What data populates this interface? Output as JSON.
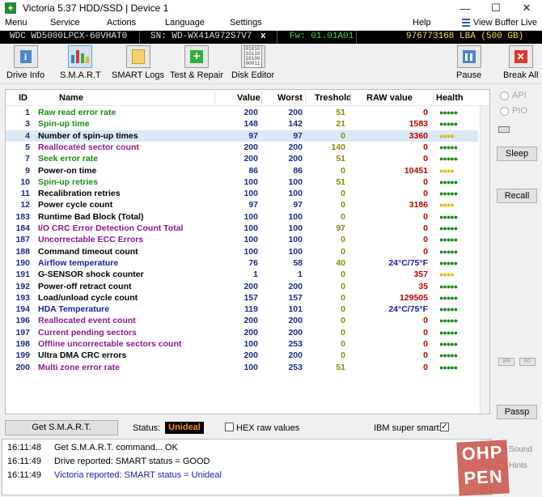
{
  "window": {
    "title": "Victoria 5.37 HDD/SSD | Device 1"
  },
  "menu": {
    "items": [
      "Menu",
      "Service",
      "Actions",
      "Language",
      "Settings",
      "Help"
    ],
    "buffer_live": "View Buffer Live"
  },
  "device": {
    "model": "WDC WD5000LPCX-60VHAT0",
    "serial": "SN: WD-WX41A972S7V7",
    "close": "x",
    "firmware": "Fw: 01.01A01",
    "lba": "976773168 LBA (500 GB)"
  },
  "toolbar": {
    "drive_info": "Drive Info",
    "smart": "S.M.A.R.T",
    "smart_logs": "SMART Logs",
    "test_repair": "Test & Repair",
    "disk_editor": "Disk Editor",
    "pause": "Pause",
    "break_all": "Break All",
    "disk_editor_glyph": "01010\n10110\n10100\n00011"
  },
  "table": {
    "headers": {
      "id": "ID",
      "name": "Name",
      "value": "Value",
      "worst": "Worst",
      "threshold": "Treshold",
      "raw": "RAW value",
      "health": "Health"
    },
    "rows": [
      {
        "id": "1",
        "name": "Raw read error rate",
        "value": "200",
        "worst": "200",
        "threshold": "51",
        "raw": "0",
        "health": "●●●●●",
        "name_color": "#1a8a1a",
        "health_color": "#1a8a1a"
      },
      {
        "id": "3",
        "name": "Spin-up time",
        "value": "148",
        "worst": "142",
        "threshold": "21",
        "raw": "1583",
        "health": "●●●●●",
        "name_color": "#1a8a1a",
        "health_color": "#1a8a1a"
      },
      {
        "id": "4",
        "name": "Number of spin-up times",
        "value": "97",
        "worst": "97",
        "threshold": "0",
        "raw": "3360",
        "health": "●●●●",
        "name_color": "#000000",
        "health_color": "#e8b800"
      },
      {
        "id": "5",
        "name": "Reallocated sector count",
        "value": "200",
        "worst": "200",
        "threshold": "140",
        "raw": "0",
        "health": "●●●●●",
        "name_color": "#8a1a8a",
        "health_color": "#1a8a1a"
      },
      {
        "id": "7",
        "name": "Seek error rate",
        "value": "200",
        "worst": "200",
        "threshold": "51",
        "raw": "0",
        "health": "●●●●●",
        "name_color": "#1a8a1a",
        "health_color": "#1a8a1a"
      },
      {
        "id": "9",
        "name": "Power-on time",
        "value": "86",
        "worst": "86",
        "threshold": "0",
        "raw": "10451",
        "health": "●●●●",
        "name_color": "#000000",
        "health_color": "#e8b800"
      },
      {
        "id": "10",
        "name": "Spin-up retries",
        "value": "100",
        "worst": "100",
        "threshold": "51",
        "raw": "0",
        "health": "●●●●●",
        "name_color": "#1a8a1a",
        "health_color": "#1a8a1a"
      },
      {
        "id": "11",
        "name": "Recalibration retries",
        "value": "100",
        "worst": "100",
        "threshold": "0",
        "raw": "0",
        "health": "●●●●●",
        "name_color": "#000000",
        "health_color": "#1a8a1a"
      },
      {
        "id": "12",
        "name": "Power cycle count",
        "value": "97",
        "worst": "97",
        "threshold": "0",
        "raw": "3186",
        "health": "●●●●",
        "name_color": "#000000",
        "health_color": "#e8b800"
      },
      {
        "id": "183",
        "name": "Runtime Bad Block (Total)",
        "value": "100",
        "worst": "100",
        "threshold": "0",
        "raw": "0",
        "health": "●●●●●",
        "name_color": "#000000",
        "health_color": "#1a8a1a"
      },
      {
        "id": "184",
        "name": "I/O CRC Error Detection Count Total",
        "value": "100",
        "worst": "100",
        "threshold": "97",
        "raw": "0",
        "health": "●●●●●",
        "name_color": "#8a1a8a",
        "health_color": "#1a8a1a"
      },
      {
        "id": "187",
        "name": "Uncorrectable ECC Errors",
        "value": "100",
        "worst": "100",
        "threshold": "0",
        "raw": "0",
        "health": "●●●●●",
        "name_color": "#8a1a8a",
        "health_color": "#1a8a1a"
      },
      {
        "id": "188",
        "name": "Command timeout count",
        "value": "100",
        "worst": "100",
        "threshold": "0",
        "raw": "0",
        "health": "●●●●●",
        "name_color": "#000000",
        "health_color": "#1a8a1a"
      },
      {
        "id": "190",
        "name": "Airflow temperature",
        "value": "76",
        "worst": "58",
        "threshold": "40",
        "raw": "24°C/75°F",
        "health": "●●●●●",
        "name_color": "#1a1aa8",
        "health_color": "#1a8a1a"
      },
      {
        "id": "191",
        "name": "G-SENSOR shock counter",
        "value": "1",
        "worst": "1",
        "threshold": "0",
        "raw": "357",
        "health": "●●●●",
        "name_color": "#000000",
        "health_color": "#e8b800"
      },
      {
        "id": "192",
        "name": "Power-off retract count",
        "value": "200",
        "worst": "200",
        "threshold": "0",
        "raw": "35",
        "health": "●●●●●",
        "name_color": "#000000",
        "health_color": "#1a8a1a"
      },
      {
        "id": "193",
        "name": "Load/unload cycle count",
        "value": "157",
        "worst": "157",
        "threshold": "0",
        "raw": "129505",
        "health": "●●●●●",
        "name_color": "#000000",
        "health_color": "#1a8a1a"
      },
      {
        "id": "194",
        "name": "HDA Temperature",
        "value": "119",
        "worst": "101",
        "threshold": "0",
        "raw": "24°C/75°F",
        "health": "●●●●●",
        "name_color": "#1a1aa8",
        "health_color": "#1a8a1a"
      },
      {
        "id": "196",
        "name": "Reallocated event count",
        "value": "200",
        "worst": "200",
        "threshold": "0",
        "raw": "0",
        "health": "●●●●●",
        "name_color": "#8a1a8a",
        "health_color": "#1a8a1a"
      },
      {
        "id": "197",
        "name": "Current pending sectors",
        "value": "200",
        "worst": "200",
        "threshold": "0",
        "raw": "0",
        "health": "●●●●●",
        "name_color": "#8a1a8a",
        "health_color": "#1a8a1a"
      },
      {
        "id": "198",
        "name": "Offline uncorrectable sectors count",
        "value": "100",
        "worst": "253",
        "threshold": "0",
        "raw": "0",
        "health": "●●●●●",
        "name_color": "#8a1a8a",
        "health_color": "#1a8a1a"
      },
      {
        "id": "199",
        "name": "Ultra DMA CRC errors",
        "value": "200",
        "worst": "200",
        "threshold": "0",
        "raw": "0",
        "health": "●●●●●",
        "name_color": "#000000",
        "health_color": "#1a8a1a"
      },
      {
        "id": "200",
        "name": "Multi zone error rate",
        "value": "100",
        "worst": "253",
        "threshold": "51",
        "raw": "0",
        "health": "●●●●●",
        "name_color": "#8a1a8a",
        "health_color": "#1a8a1a"
      }
    ],
    "selected_row": 2
  },
  "right_panel": {
    "api": "API",
    "pio": "PIO",
    "sleep": "Sleep",
    "recall": "Recall",
    "passp": "Passp",
    "wr": "WR",
    "rd": "RD",
    "sound": "Sound",
    "hints": "Hints"
  },
  "status": {
    "get_smart": "Get S.M.A.R.T.",
    "status_label": "Status:",
    "status_value": "Unideal",
    "hex_raw": "HEX raw values",
    "ibm_super_smart": "IBM super smart:",
    "ibm_checked": "✓"
  },
  "log": [
    {
      "time": "16:11:48",
      "msg": "Get S.M.A.R.T. command... OK",
      "color": "#000000"
    },
    {
      "time": "16:11:49",
      "msg": "Drive reported: SMART status = GOOD",
      "color": "#000000"
    },
    {
      "time": "16:11:49",
      "msg": "Victoria reported: SMART status = Unideal",
      "color": "#1a1aa8"
    }
  ],
  "watermark": {
    "text": "OHP\nPEN"
  },
  "colors": {
    "id": "#1a2a8a",
    "value": "#1a2a8a",
    "threshold": "#8a8a00",
    "raw_nonzero": "#c00000",
    "raw_temp": "#1a1aa8",
    "raw_zero": "#c00000"
  }
}
